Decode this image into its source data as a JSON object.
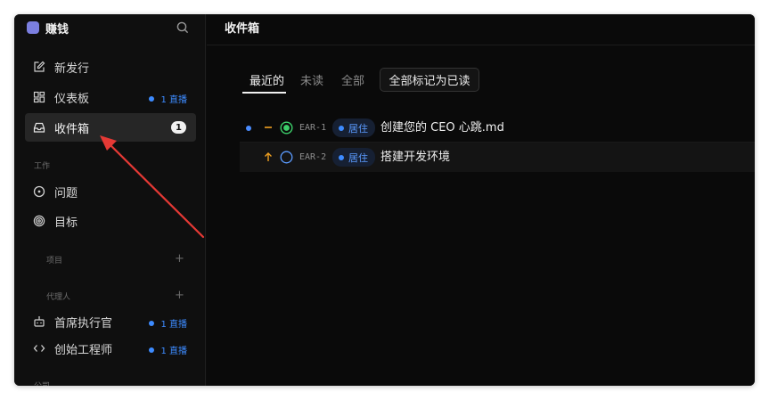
{
  "sidebar": {
    "brand_name": "赚钱",
    "nav": [
      {
        "label": "新发行"
      },
      {
        "label": "仪表板",
        "badge": "1 直播"
      },
      {
        "label": "收件箱",
        "count": "1"
      }
    ],
    "section_work": "工作",
    "work_items": [
      {
        "label": "问题"
      },
      {
        "label": "目标"
      }
    ],
    "section_projects": "项目",
    "section_agents": "代理人",
    "agents": [
      {
        "label": "首席执行官",
        "badge": "1 直播"
      },
      {
        "label": "创始工程师",
        "badge": "1 直播"
      }
    ],
    "section_company": "公司",
    "plus": "+"
  },
  "main": {
    "title": "收件箱",
    "tabs": [
      "最近的",
      "未读",
      "全部"
    ],
    "mark_all_read": "全部标记为已读",
    "rows": [
      {
        "id": "EAR-1",
        "label": "居住",
        "title": "创建您的 CEO 心跳.md",
        "priority_symbol": "—",
        "status": "in-progress"
      },
      {
        "id": "EAR-2",
        "label": "居住",
        "title": "搭建开发环境",
        "priority_symbol": "↑",
        "status": "todo"
      }
    ]
  },
  "colors": {
    "accent_blue": "#3d8bff",
    "status_green": "#3ccf6a",
    "priority_orange": "#f0a020",
    "annotation_red": "#e53935"
  }
}
